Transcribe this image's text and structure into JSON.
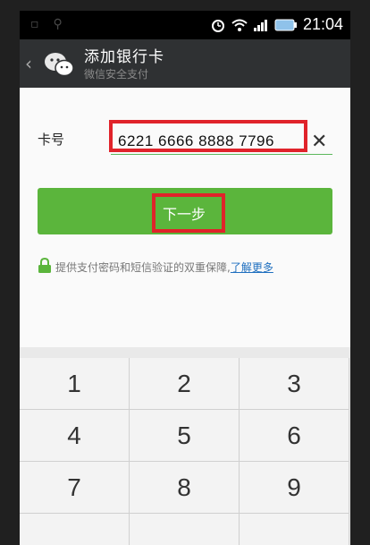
{
  "status_bar": {
    "time": "21:04"
  },
  "header": {
    "title": "添加银行卡",
    "subtitle": "微信安全支付"
  },
  "form": {
    "card_label": "卡号",
    "card_number": "6221 6666 8888 7796"
  },
  "next_button": {
    "label": "下一步"
  },
  "notice": {
    "text": "提供支付密码和短信验证的双重保障,",
    "link": "了解更多"
  },
  "keypad": {
    "keys": [
      "1",
      "2",
      "3",
      "4",
      "5",
      "6",
      "7",
      "8",
      "9"
    ]
  },
  "colors": {
    "accent_green": "#5bb53c",
    "highlight_red": "#e0232a"
  }
}
